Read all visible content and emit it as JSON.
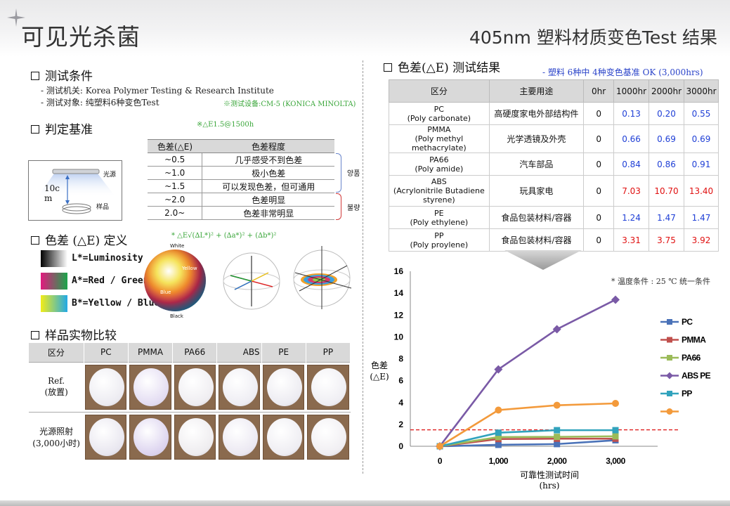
{
  "header": {
    "title": "可见光杀菌",
    "subtitle": "405nm 塑料材质变色Test 结果"
  },
  "conditions": {
    "heading": "测试条件",
    "agency": "- 测试机关: Korea Polymer Testing & Research Institute",
    "target": "- 测试对象: 纯塑料6种变色Test",
    "equipment_note": "※测试设备:CM-5 (KONICA MINOLTA)"
  },
  "criteria": {
    "heading": "判定基准",
    "note": "※△E1.5@1500h",
    "columns": [
      "色差(△E)",
      "色差程度"
    ],
    "rows": [
      [
        "~0.5",
        "几乎感受不到色差"
      ],
      [
        "~1.0",
        "极小色差"
      ],
      [
        "~1.5",
        "可以发现色差，但可通用"
      ],
      [
        "~2.0",
        "色差明显"
      ],
      [
        "2.0~",
        "色差非常明显"
      ]
    ],
    "good_label": "양품",
    "bad_label": "불량",
    "diagram": {
      "light_label": "光源",
      "distance_label": "10cm",
      "sample_label": "样品"
    },
    "good_color": "#6a86cc",
    "bad_color": "#d23a3a"
  },
  "color_def": {
    "heading": "色差 (△E) 定义",
    "formula": "* △E√(∆L*)² + (∆a*)² + (∆b*)²",
    "swatches": [
      {
        "label": "L*=Luminosity",
        "icon": "luminosity-swatch-icon"
      },
      {
        "label": "A*=Red / Green",
        "icon": "red-green-swatch-icon"
      },
      {
        "label": "B*=Yellow / Blue",
        "icon": "yellow-blue-swatch-icon"
      }
    ],
    "sphere_labels": {
      "white": "White",
      "black": "Black",
      "yellow": "Yellow",
      "blue": "Blue"
    }
  },
  "samples": {
    "heading": "样品实物比较",
    "columns": [
      "区分",
      "PC",
      "PMMA",
      "PA66",
      "ABS",
      "PE",
      "PP"
    ],
    "row_ref": [
      "Ref.",
      "(放置)"
    ],
    "row_exp": [
      "光源照射",
      "(3,000小时)"
    ],
    "ref_colors": [
      "#ecebf1",
      "#e3dcf2",
      "#efedf1",
      "#eeedf3",
      "#ecebf1",
      "#efeef3"
    ],
    "exp_colors": [
      "#e8e6ef",
      "#dcd3ef",
      "#eeecef",
      "#ebe8f2",
      "#eeedf2",
      "#f0eef2"
    ]
  },
  "results": {
    "heading": "色差(△E) 测试结果",
    "note": "- 塑料 6种中 4种变色基准 OK (3,000hrs)",
    "columns": [
      "区分",
      "主要用途",
      "0hr",
      "1000hr",
      "2000hr",
      "3000hr"
    ],
    "rows": [
      {
        "name": [
          "PC",
          "(Poly carbonate)"
        ],
        "use": "高硬度家电外部结构件",
        "v0": "0",
        "v1": "0.13",
        "v2": "0.20",
        "v3": "0.55",
        "status": "ok"
      },
      {
        "name": [
          "PMMA",
          "(Poly methyl methacrylate)"
        ],
        "use": "光学透镜及外壳",
        "v0": "0",
        "v1": "0.66",
        "v2": "0.69",
        "v3": "0.69",
        "status": "ok"
      },
      {
        "name": [
          "PA66",
          "(Poly amide)"
        ],
        "use": "汽车部品",
        "v0": "0",
        "v1": "0.84",
        "v2": "0.86",
        "v3": "0.91",
        "status": "ok"
      },
      {
        "name": [
          "ABS",
          "(Acrylonitrile Butadiene",
          "styrene)"
        ],
        "use": "玩具家电",
        "v0": "0",
        "v1": "7.03",
        "v2": "10.70",
        "v3": "13.40",
        "status": "ng"
      },
      {
        "name": [
          "PE",
          "(Poly ethylene)"
        ],
        "use": "食品包装材料/容器",
        "v0": "0",
        "v1": "1.24",
        "v2": "1.47",
        "v3": "1.47",
        "status": "ok"
      },
      {
        "name": [
          "PP",
          "(Poly proylene)"
        ],
        "use": "食品包装材料/容器",
        "v0": "0",
        "v1": "3.31",
        "v2": "3.75",
        "v3": "3.92",
        "status": "ng"
      }
    ],
    "ok_color": "#1f3fd6",
    "ng_color": "#e01010"
  },
  "chart_data": {
    "type": "line",
    "x": [
      0,
      1000,
      2000,
      3000
    ],
    "x_tick_labels": [
      "0",
      "1,000",
      "2,000",
      "3,000"
    ],
    "xlabel": [
      "可靠性测试时间",
      "(hrs)"
    ],
    "ylabel": [
      "色差",
      "(△E)"
    ],
    "ylim": [
      0,
      16
    ],
    "y_ticks": [
      0,
      2,
      4,
      6,
      8,
      10,
      12,
      14,
      16
    ],
    "threshold": 1.5,
    "threshold_color": "#d11",
    "annotation": "* 温度条件 : 25 ℃ 统一条件",
    "legend_position": "right",
    "series": [
      {
        "name": "PC",
        "values": [
          0,
          0.13,
          0.2,
          0.55
        ],
        "color": "#4a72b8",
        "marker": "square"
      },
      {
        "name": "PMMA",
        "values": [
          0,
          0.66,
          0.69,
          0.69
        ],
        "color": "#c0504d",
        "marker": "square"
      },
      {
        "name": "PA66",
        "values": [
          0,
          0.84,
          0.86,
          0.91
        ],
        "color": "#9bbb59",
        "marker": "square"
      },
      {
        "name": "ABS PE",
        "values": [
          0,
          7.03,
          10.7,
          13.4
        ],
        "color": "#7a5aa6",
        "marker": "diamond"
      },
      {
        "name": "PP",
        "values": [
          0,
          1.24,
          1.47,
          1.47
        ],
        "color": "#31a3bd",
        "marker": "square"
      },
      {
        "name": "",
        "values": [
          0,
          3.31,
          3.75,
          3.92
        ],
        "color": "#f39a3b",
        "marker": "circle"
      }
    ]
  }
}
